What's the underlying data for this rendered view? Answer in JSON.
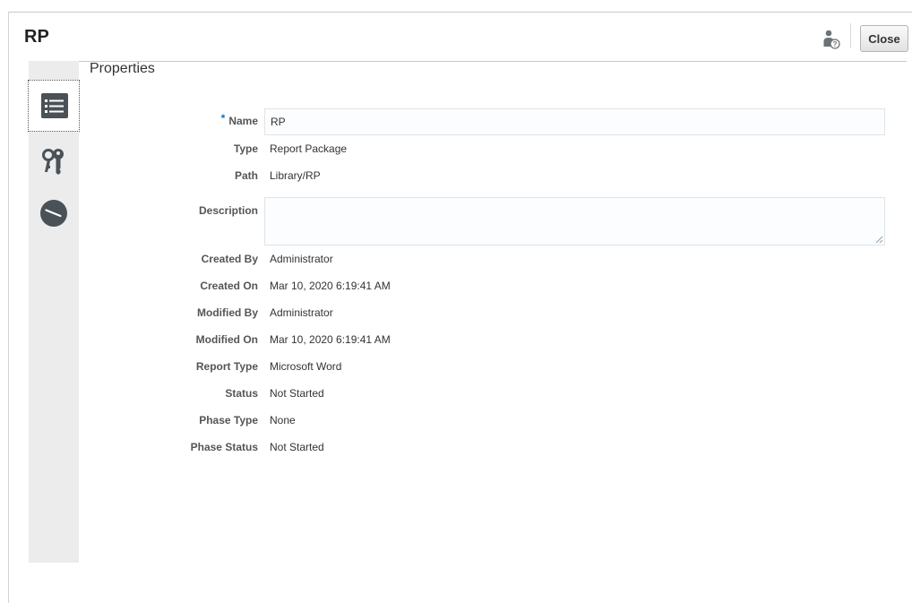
{
  "header": {
    "title": "RP",
    "close_label": "Close",
    "help_icon": "user-help-icon"
  },
  "sidebar": {
    "tabs": [
      {
        "id": "properties",
        "icon": "list-icon",
        "active": true
      },
      {
        "id": "access",
        "icon": "keys-icon",
        "active": false
      },
      {
        "id": "history",
        "icon": "clock-icon",
        "active": false
      }
    ]
  },
  "panel": {
    "title": "Properties",
    "required_marker": "*",
    "fields": {
      "name": {
        "label": "Name",
        "value": "RP"
      },
      "type": {
        "label": "Type",
        "value": "Report Package"
      },
      "path": {
        "label": "Path",
        "value": "Library/RP"
      },
      "description": {
        "label": "Description",
        "value": ""
      },
      "created_by": {
        "label": "Created By",
        "value": "Administrator"
      },
      "created_on": {
        "label": "Created On",
        "value": "Mar 10, 2020 6:19:41 AM"
      },
      "modified_by": {
        "label": "Modified By",
        "value": "Administrator"
      },
      "modified_on": {
        "label": "Modified On",
        "value": "Mar 10, 2020 6:19:41 AM"
      },
      "report_type": {
        "label": "Report Type",
        "value": "Microsoft Word"
      },
      "status": {
        "label": "Status",
        "value": "Not Started"
      },
      "phase_type": {
        "label": "Phase Type",
        "value": "None"
      },
      "phase_status": {
        "label": "Phase Status",
        "value": "Not Started"
      }
    }
  },
  "colors": {
    "required": "#0572ce",
    "icon": "#4a5258",
    "sidebar_bg": "#ececec"
  }
}
